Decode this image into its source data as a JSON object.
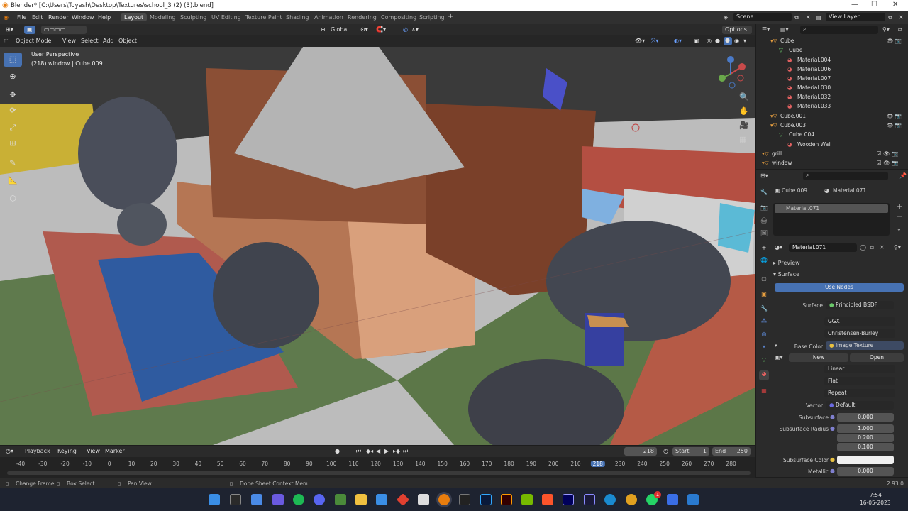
{
  "titlebar": {
    "title": "Blender* [C:\\Users\\Toyesh\\Desktop\\Textures\\school_3 (2) (3).blend]",
    "min": "—",
    "max": "☐",
    "close": "✕"
  },
  "menu": {
    "file": "File",
    "edit": "Edit",
    "render": "Render",
    "window": "Window",
    "help": "Help"
  },
  "workspaces": [
    "Layout",
    "Modeling",
    "Sculpting",
    "UV Editing",
    "Texture Paint",
    "Shading",
    "Animation",
    "Rendering",
    "Compositing",
    "Scripting"
  ],
  "scene": {
    "name": "Scene",
    "view_layer": "View Layer"
  },
  "toolbar": {
    "orientation": "Global",
    "options": "Options"
  },
  "header": {
    "mode": "Object Mode",
    "view": "View",
    "select": "Select",
    "add": "Add",
    "object": "Object"
  },
  "overlay": {
    "perspective": "User Perspective",
    "info": "(218) window | Cube.009"
  },
  "outliner": {
    "rows": [
      {
        "label": "Cube",
        "indent": 1
      },
      {
        "label": "Cube",
        "indent": 2
      },
      {
        "label": "Material.004",
        "indent": 3
      },
      {
        "label": "Material.006",
        "indent": 3
      },
      {
        "label": "Material.007",
        "indent": 3
      },
      {
        "label": "Material.030",
        "indent": 3
      },
      {
        "label": "Material.032",
        "indent": 3
      },
      {
        "label": "Material.033",
        "indent": 3
      },
      {
        "label": "Cube.001",
        "indent": 1
      },
      {
        "label": "Cube.003",
        "indent": 1
      },
      {
        "label": "Cube.004",
        "indent": 2
      },
      {
        "label": "Wooden Wall",
        "indent": 3
      },
      {
        "label": "grill",
        "indent": 0
      },
      {
        "label": "window",
        "indent": 0
      }
    ]
  },
  "properties": {
    "object": "Cube.009",
    "material": "Material.071",
    "slot": "Material.071",
    "datablock": "Material.071",
    "preview": "Preview",
    "surface_panel": "Surface",
    "use_nodes": "Use Nodes",
    "surface_label": "Surface",
    "surface_value": "Principled BSDF",
    "distribution": "GGX",
    "subsurface_method": "Christensen-Burley",
    "base_color_label": "Base Color",
    "base_color_value": "Image Texture",
    "new": "New",
    "open": "Open",
    "interpolation": "Linear",
    "projection": "Flat",
    "extension": "Repeat",
    "vector_label": "Vector",
    "vector_value": "Default",
    "subsurface_label": "Subsurface",
    "subsurface_value": "0.000",
    "subsurface_radius_label": "Subsurface Radius",
    "radius": [
      "1.000",
      "0.200",
      "0.100"
    ],
    "subsurface_color_label": "Subsurface Color",
    "metallic_label": "Metallic",
    "metallic_value": "0.000"
  },
  "timeline": {
    "playback": "Playback",
    "keying": "Keying",
    "view": "View",
    "marker": "Marker",
    "current": "218",
    "start_label": "Start",
    "start": "1",
    "end_label": "End",
    "end": "250",
    "ticks": [
      "-40",
      "-30",
      "-20",
      "-10",
      "0",
      "10",
      "20",
      "30",
      "40",
      "50",
      "60",
      "70",
      "80",
      "90",
      "100",
      "110",
      "120",
      "130",
      "140",
      "150",
      "160",
      "170",
      "180",
      "190",
      "200",
      "210",
      "218",
      "230",
      "240",
      "250",
      "260",
      "270",
      "280"
    ]
  },
  "status": {
    "change_frame": "Change Frame",
    "box_select": "Box Select",
    "pan_view": "Pan View",
    "context_menu": "Dope Sheet Context Menu",
    "version": "2.93.0"
  },
  "taskbar": {
    "time": "7:54",
    "date": "16-05-2023",
    "notify": "1"
  },
  "colors": {
    "accent": "#4772b3",
    "active_frame": "#4772b3"
  }
}
